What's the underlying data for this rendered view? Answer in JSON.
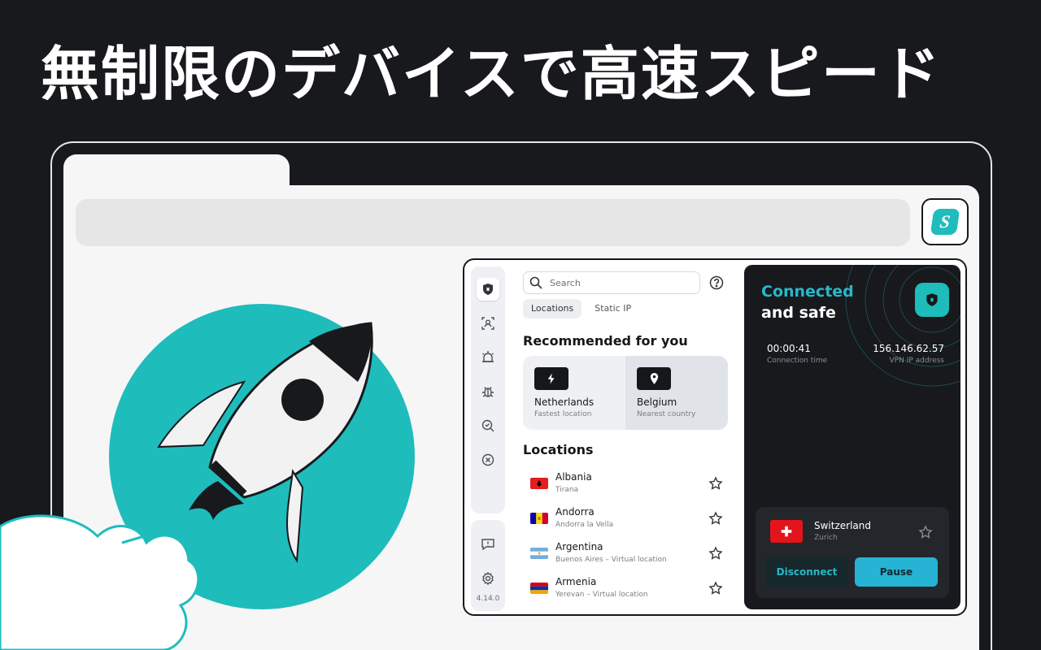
{
  "headline": "無制限のデバイスで高速スピード",
  "extension": {
    "logo_letter": "S"
  },
  "popup": {
    "version": "4.14.0",
    "search_placeholder": "Search",
    "tabs": [
      {
        "label": "Locations",
        "active": true
      },
      {
        "label": "Static IP",
        "active": false
      }
    ],
    "recommended_title": "Recommended for you",
    "recommended": [
      {
        "name": "Netherlands",
        "sub": "Fastest location",
        "icon": "lightning-icon"
      },
      {
        "name": "Belgium",
        "sub": "Nearest country",
        "icon": "location-pin-icon"
      }
    ],
    "locations_title": "Locations",
    "locations": [
      {
        "name": "Albania",
        "sub": "Tirana",
        "flag": "albania-flag"
      },
      {
        "name": "Andorra",
        "sub": "Andorra la Vella",
        "flag": "andorra-flag"
      },
      {
        "name": "Argentina",
        "sub": "Buenos Aires – Virtual location",
        "flag": "argentina-flag"
      },
      {
        "name": "Armenia",
        "sub": "Yerevan – Virtual location",
        "flag": "armenia-flag"
      }
    ],
    "status": {
      "line1": "Connected",
      "line2": "and safe",
      "connection_time": "00:00:41",
      "connection_time_label": "Connection time",
      "ip": "156.146.62.57",
      "ip_label": "VPN IP address"
    },
    "current": {
      "name": "Switzerland",
      "sub": "Zurich",
      "disconnect_label": "Disconnect",
      "pause_label": "Pause"
    }
  },
  "colors": {
    "accent": "#1fbcbc",
    "connected_text": "#2ab7c9",
    "background": "#17191c"
  }
}
